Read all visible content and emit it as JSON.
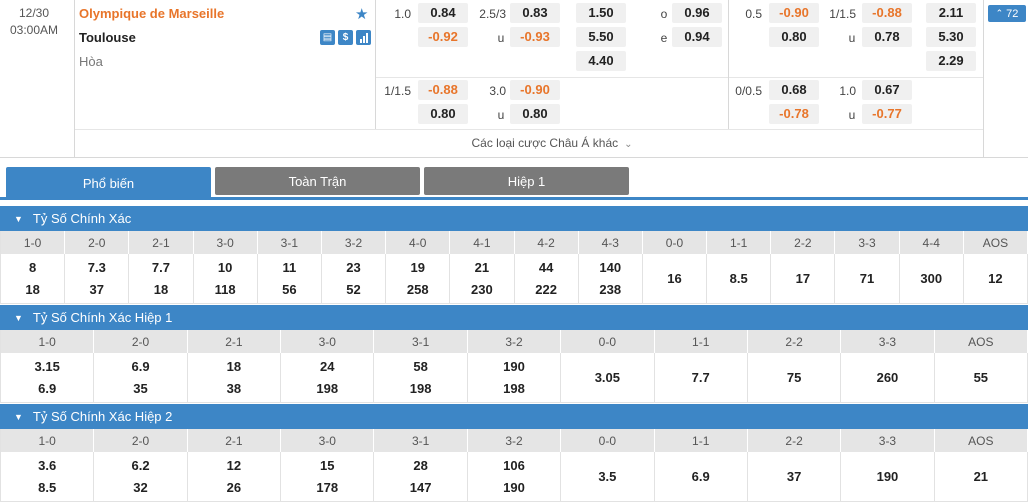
{
  "match": {
    "date": "12/30",
    "time": "03:00AM",
    "home_team": "Olympique de Marseille",
    "away_team": "Toulouse",
    "draw_label": "Hòa",
    "icons": [
      "star-icon",
      "tv-icon",
      "dollar-icon",
      "stats-icon"
    ],
    "more_bets": "Các loại cược Châu Á khác",
    "count_badge": "72"
  },
  "fulltime": {
    "hdp_main": {
      "line": "1.0",
      "home": "0.84",
      "away": "-0.92"
    },
    "ou_main": {
      "line": "2.5/3",
      "over_label": "u",
      "over": "0.83",
      "under": "-0.93"
    },
    "x12": {
      "home": "1.50",
      "away": "5.50",
      "draw": "4.40"
    },
    "oe": {
      "odd_label": "o",
      "odd": "0.96",
      "even_label": "e",
      "even": "0.94"
    },
    "hdp_alt": {
      "line": "1/1.5",
      "home": "-0.88",
      "away": "0.80"
    },
    "ou_alt": {
      "line": "3.0",
      "label": "u",
      "over": "-0.90",
      "under": "0.80"
    }
  },
  "firsthalf": {
    "hdp_main": {
      "line": "0.5",
      "home": "-0.90",
      "away": "0.80"
    },
    "ou_main": {
      "line": "1/1.5",
      "label": "u",
      "over": "-0.88",
      "under": "0.78"
    },
    "x12": {
      "home": "2.11",
      "away": "5.30",
      "draw": "2.29"
    },
    "hdp_alt": {
      "line": "0/0.5",
      "home": "0.68",
      "away": "-0.78"
    },
    "ou_alt": {
      "line": "1.0",
      "label": "u",
      "over": "0.67",
      "under": "-0.77"
    }
  },
  "tabs": [
    "Phổ biến",
    "Toàn Trận",
    "Hiệp 1"
  ],
  "sections": [
    {
      "title": "Tỷ Số Chính Xác",
      "cols": [
        {
          "h": "1-0",
          "a": "8",
          "b": "18"
        },
        {
          "h": "2-0",
          "a": "7.3",
          "b": "37"
        },
        {
          "h": "2-1",
          "a": "7.7",
          "b": "18"
        },
        {
          "h": "3-0",
          "a": "10",
          "b": "118"
        },
        {
          "h": "3-1",
          "a": "11",
          "b": "56"
        },
        {
          "h": "3-2",
          "a": "23",
          "b": "52"
        },
        {
          "h": "4-0",
          "a": "19",
          "b": "258"
        },
        {
          "h": "4-1",
          "a": "21",
          "b": "230"
        },
        {
          "h": "4-2",
          "a": "44",
          "b": "222"
        },
        {
          "h": "4-3",
          "a": "140",
          "b": "238"
        },
        {
          "h": "0-0",
          "s": "16"
        },
        {
          "h": "1-1",
          "s": "8.5"
        },
        {
          "h": "2-2",
          "s": "17"
        },
        {
          "h": "3-3",
          "s": "71"
        },
        {
          "h": "4-4",
          "s": "300"
        },
        {
          "h": "AOS",
          "s": "12"
        }
      ]
    },
    {
      "title": "Tỷ Số Chính Xác Hiệp 1",
      "cols": [
        {
          "h": "1-0",
          "a": "3.15",
          "b": "6.9"
        },
        {
          "h": "2-0",
          "a": "6.9",
          "b": "35"
        },
        {
          "h": "2-1",
          "a": "18",
          "b": "38"
        },
        {
          "h": "3-0",
          "a": "24",
          "b": "198"
        },
        {
          "h": "3-1",
          "a": "58",
          "b": "198"
        },
        {
          "h": "3-2",
          "a": "190",
          "b": "198"
        },
        {
          "h": "0-0",
          "s": "3.05"
        },
        {
          "h": "1-1",
          "s": "7.7"
        },
        {
          "h": "2-2",
          "s": "75"
        },
        {
          "h": "3-3",
          "s": "260"
        },
        {
          "h": "AOS",
          "s": "55"
        }
      ]
    },
    {
      "title": "Tỷ Số Chính Xác Hiệp 2",
      "cols": [
        {
          "h": "1-0",
          "a": "3.6",
          "b": "8.5"
        },
        {
          "h": "2-0",
          "a": "6.2",
          "b": "32"
        },
        {
          "h": "2-1",
          "a": "12",
          "b": "26"
        },
        {
          "h": "3-0",
          "a": "15",
          "b": "178"
        },
        {
          "h": "3-1",
          "a": "28",
          "b": "147"
        },
        {
          "h": "3-2",
          "a": "106",
          "b": "190"
        },
        {
          "h": "0-0",
          "s": "3.5"
        },
        {
          "h": "1-1",
          "s": "6.9"
        },
        {
          "h": "2-2",
          "s": "37"
        },
        {
          "h": "3-3",
          "s": "190"
        },
        {
          "h": "AOS",
          "s": "21"
        }
      ]
    }
  ]
}
